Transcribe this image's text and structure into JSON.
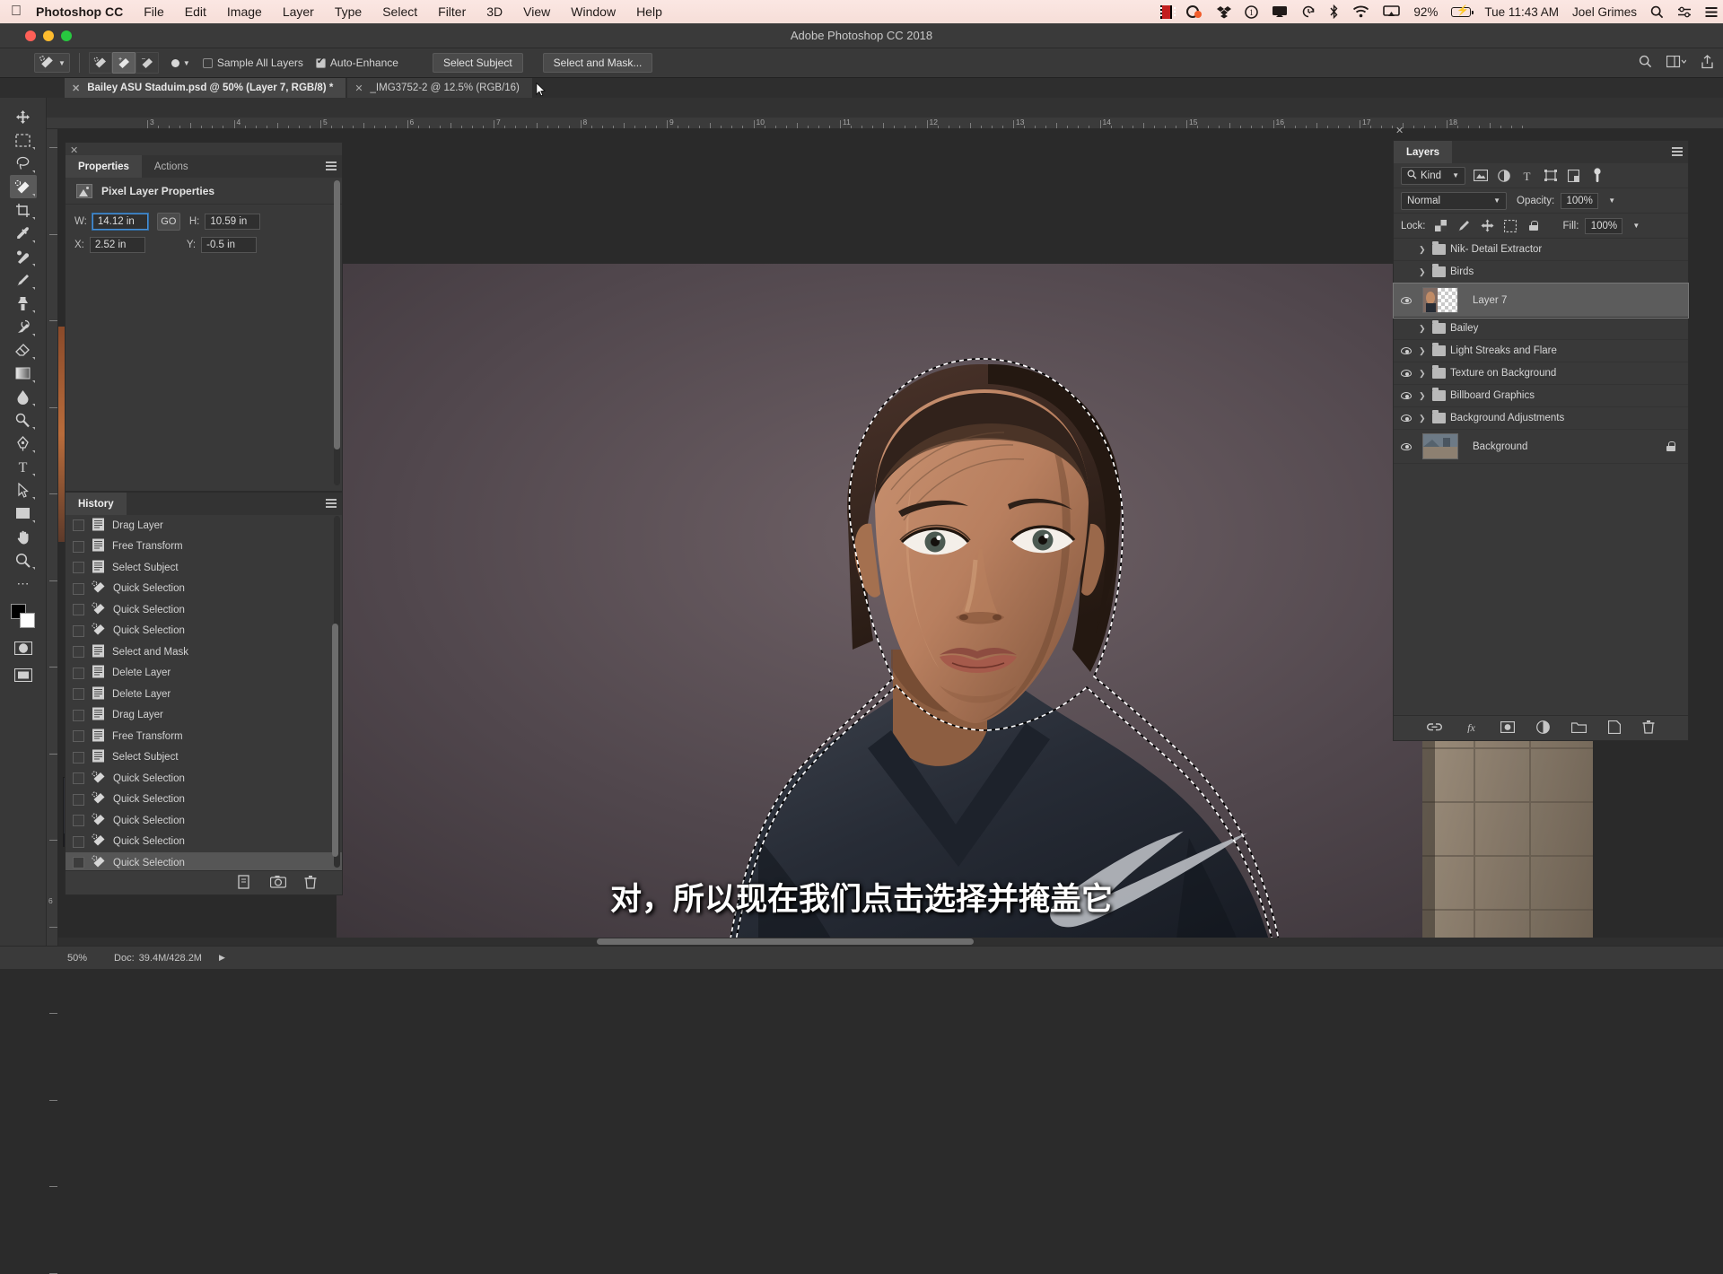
{
  "menubar": {
    "apple_icon": "apple-icon",
    "app_name": "Photoshop CC",
    "items": [
      "File",
      "Edit",
      "Image",
      "Layer",
      "Type",
      "Select",
      "Filter",
      "3D",
      "View",
      "Window",
      "Help"
    ],
    "status_icons": [
      "film-icon",
      "carbon-copy-cloner-icon",
      "dropbox-icon",
      "info-circle-icon",
      "display-icon",
      "time-machine-icon",
      "bluetooth-icon",
      "wifi-icon",
      "airplay-icon"
    ],
    "battery_percent": "92%",
    "battery_icon": "battery-charging-icon",
    "clock": "Tue 11:43 AM",
    "user_name": "Joel Grimes",
    "search_icon": "spotlight-search-icon",
    "control_center_icon": "control-center-icon",
    "notification_icon": "notification-center-icon"
  },
  "window": {
    "title": "Adobe Photoshop CC 2018",
    "traffic_lights": [
      "close",
      "minimize",
      "zoom"
    ]
  },
  "options_bar": {
    "tool_preset_icon": "quick-selection-tool-icon",
    "modes": [
      "new-selection-icon",
      "add-to-selection-icon",
      "subtract-from-selection-icon"
    ],
    "active_mode_index": 1,
    "brush_size": "9",
    "brush_label": "brush-size-picker",
    "sample_all_layers": {
      "label": "Sample All Layers",
      "checked": false
    },
    "auto_enhance": {
      "label": "Auto-Enhance",
      "checked": true
    },
    "select_subject_label": "Select Subject",
    "select_and_mask_label": "Select and Mask...",
    "right_icons": [
      "search-icon",
      "workspace-switcher-icon",
      "share-icon"
    ]
  },
  "tabs": [
    {
      "title": "Bailey ASU Staduim.psd @ 50% (Layer 7, RGB/8) *",
      "active": true
    },
    {
      "title": "_IMG3752-2 @ 12.5% (RGB/16)",
      "active": false
    }
  ],
  "toolbar": {
    "tools": [
      "move-tool",
      "rectangular-marquee-tool",
      "lasso-tool",
      "quick-selection-tool",
      "crop-tool",
      "eyedropper-tool",
      "spot-healing-brush-tool",
      "brush-tool",
      "clone-stamp-tool",
      "history-brush-tool",
      "eraser-tool",
      "gradient-tool",
      "blur-tool",
      "dodge-tool",
      "pen-tool",
      "type-tool",
      "path-selection-tool",
      "rectangle-tool",
      "hand-tool",
      "zoom-tool",
      "edit-toolbar"
    ],
    "selected_tool": "quick-selection-tool",
    "foreground_color": "#000000",
    "background_color": "#ffffff",
    "quick_mask_icon": "quick-mask-mode-icon",
    "screen_mode_icon": "screen-mode-icon"
  },
  "rulers": {
    "horizontal_units": [
      "3",
      "4",
      "5",
      "6",
      "7",
      "8",
      "9",
      "10",
      "11",
      "12",
      "13",
      "14",
      "15",
      "16",
      "17",
      "18"
    ],
    "vertical_units": [
      "6"
    ]
  },
  "properties_panel": {
    "tabs": [
      {
        "label": "Properties",
        "active": true
      },
      {
        "label": "Actions",
        "active": false
      }
    ],
    "header": "Pixel Layer Properties",
    "header_icon": "pixel-layer-icon",
    "fields": {
      "w_label": "W:",
      "w_value": "14.12 in",
      "link_label": "GO",
      "link_icon": "link-chain-icon",
      "h_label": "H:",
      "h_value": "10.59 in",
      "x_label": "X:",
      "x_value": "2.52 in",
      "y_label": "Y:",
      "y_value": "-0.5 in"
    }
  },
  "history_panel": {
    "tab": "History",
    "items": [
      {
        "label": "Drag Layer",
        "icon": "document-icon",
        "selected": false
      },
      {
        "label": "Free Transform",
        "icon": "document-icon",
        "selected": false
      },
      {
        "label": "Select Subject",
        "icon": "document-icon",
        "selected": false
      },
      {
        "label": "Quick Selection",
        "icon": "quick-selection-icon",
        "selected": false
      },
      {
        "label": "Quick Selection",
        "icon": "quick-selection-icon",
        "selected": false
      },
      {
        "label": "Quick Selection",
        "icon": "quick-selection-icon",
        "selected": false
      },
      {
        "label": "Select and Mask",
        "icon": "document-icon",
        "selected": false
      },
      {
        "label": "Delete Layer",
        "icon": "document-icon",
        "selected": false
      },
      {
        "label": "Delete Layer",
        "icon": "document-icon",
        "selected": false
      },
      {
        "label": "Drag Layer",
        "icon": "document-icon",
        "selected": false
      },
      {
        "label": "Free Transform",
        "icon": "document-icon",
        "selected": false
      },
      {
        "label": "Select Subject",
        "icon": "document-icon",
        "selected": false
      },
      {
        "label": "Quick Selection",
        "icon": "quick-selection-icon",
        "selected": false
      },
      {
        "label": "Quick Selection",
        "icon": "quick-selection-icon",
        "selected": false
      },
      {
        "label": "Quick Selection",
        "icon": "quick-selection-icon",
        "selected": false
      },
      {
        "label": "Quick Selection",
        "icon": "quick-selection-icon",
        "selected": false
      },
      {
        "label": "Quick Selection",
        "icon": "quick-selection-icon",
        "selected": true
      }
    ],
    "footer_icons": [
      "create-document-from-state-icon",
      "create-new-snapshot-icon",
      "delete-state-icon"
    ]
  },
  "layers_panel": {
    "tab": "Layers",
    "filter_label": "Kind",
    "filter_icon": "search-icon",
    "filter_type_icons": [
      "pixel-filter-icon",
      "adjustment-filter-icon",
      "type-filter-icon",
      "shape-filter-icon",
      "smart-object-filter-icon",
      "filter-toggle-icon"
    ],
    "blend_mode": "Normal",
    "opacity_label": "Opacity:",
    "opacity_value": "100%",
    "lock_label": "Lock:",
    "lock_icons": [
      "lock-transparent-pixels-icon",
      "lock-image-pixels-icon",
      "lock-position-icon",
      "lock-artboard-icon",
      "lock-all-icon"
    ],
    "fill_label": "Fill:",
    "fill_value": "100%",
    "layers": [
      {
        "name": "Nik- Detail Extractor",
        "type": "group",
        "visible": false,
        "selected": false,
        "locked": false
      },
      {
        "name": "Birds",
        "type": "group",
        "visible": false,
        "selected": false,
        "locked": false
      },
      {
        "name": "Layer 7",
        "type": "pixel",
        "visible": true,
        "selected": true,
        "locked": false
      },
      {
        "name": "Bailey",
        "type": "group",
        "visible": false,
        "selected": false,
        "locked": false
      },
      {
        "name": "Light Streaks and Flare",
        "type": "group",
        "visible": true,
        "selected": false,
        "locked": false
      },
      {
        "name": "Texture on Background",
        "type": "group",
        "visible": true,
        "selected": false,
        "locked": false
      },
      {
        "name": "Billboard Graphics",
        "type": "group",
        "visible": true,
        "selected": false,
        "locked": false
      },
      {
        "name": "Background Adjustments",
        "type": "group",
        "visible": true,
        "selected": false,
        "locked": false
      },
      {
        "name": "Background",
        "type": "image",
        "visible": true,
        "selected": false,
        "locked": true
      }
    ],
    "footer_icons": [
      "link-layers-icon",
      "add-layer-style-icon",
      "add-layer-mask-icon",
      "new-adjustment-layer-icon",
      "new-group-icon",
      "new-layer-icon",
      "delete-layer-icon"
    ]
  },
  "status_bar": {
    "zoom": "50%",
    "doc_label": "Doc:",
    "doc_size": "39.4M/428.2M",
    "arrow_icon": "chevron-right-icon"
  },
  "subtitle": "对，所以现在我们点击选择并掩盖它",
  "colors": {
    "menubar_bg": "#fbe7e3",
    "panel_bg": "#393939",
    "canvas_bg": "#2a2a2a",
    "selected_row": "#5c5c5c",
    "accent_blue": "#4a8fd4"
  }
}
